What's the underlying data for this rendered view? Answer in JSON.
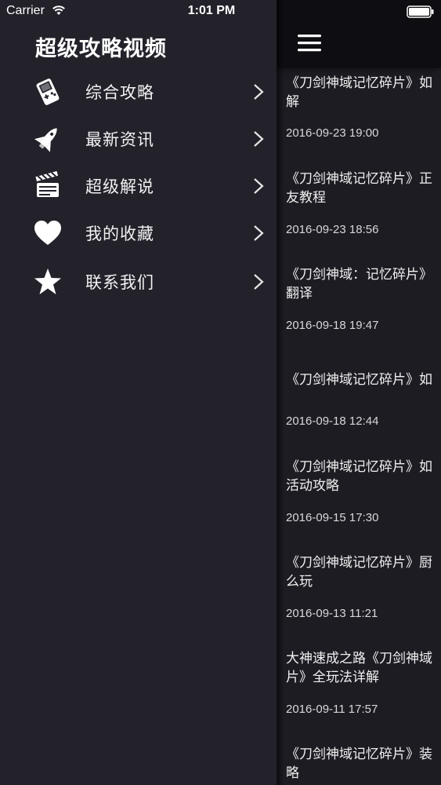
{
  "status_bar": {
    "carrier": "Carrier",
    "time": "1:01 PM",
    "wifi_icon": "wifi-icon",
    "battery_icon": "battery-icon"
  },
  "drawer": {
    "title": "超级攻略视频",
    "items": [
      {
        "label": "综合攻略",
        "icon": "gameboy-icon"
      },
      {
        "label": "最新资讯",
        "icon": "space-shuttle-icon"
      },
      {
        "label": "超级解说",
        "icon": "clapperboard-icon"
      },
      {
        "label": "我的收藏",
        "icon": "heart-icon"
      },
      {
        "label": "联系我们",
        "icon": "star-icon"
      }
    ],
    "chevron_icon": "chevron-right-icon"
  },
  "content": {
    "menu_icon": "hamburger-icon",
    "articles": [
      {
        "title": "《刀剑神域记忆碎片》如\n解",
        "date": "2016-09-23 19:00"
      },
      {
        "title": "《刀剑神域记忆碎片》正\n友教程",
        "date": "2016-09-23 18:56"
      },
      {
        "title": "《刀剑神域：记忆碎片》\n翻译",
        "date": "2016-09-18 19:47"
      },
      {
        "title": "《刀剑神域记忆碎片》如",
        "date": "2016-09-18 12:44"
      },
      {
        "title": "《刀剑神域记忆碎片》如\n活动攻略",
        "date": "2016-09-15 17:30"
      },
      {
        "title": "《刀剑神域记忆碎片》厨\n么玩",
        "date": "2016-09-13 11:21"
      },
      {
        "title": "大神速成之路《刀剑神域\n片》全玩法详解",
        "date": "2016-09-11 17:57"
      },
      {
        "title": "《刀剑神域记忆碎片》装\n略",
        "date": ""
      }
    ]
  },
  "colors": {
    "drawer_bg": "#23222b",
    "content_bg": "#1d1c23",
    "navbar_bg": "#0e0e12",
    "text": "#ffffff"
  }
}
